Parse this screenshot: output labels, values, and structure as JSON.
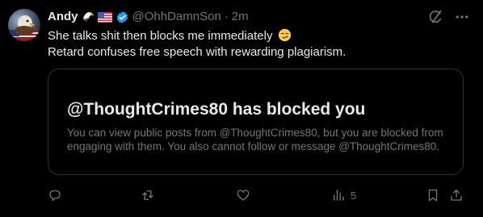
{
  "post": {
    "author": {
      "name": "Andy",
      "handle": "@OhhDamnSon",
      "time": "2m",
      "separator": "·",
      "badges": [
        "eagle-emoji",
        "us-flag-emoji",
        "verified-badge"
      ]
    },
    "text": {
      "line1": "She talks shit then blocks me immediately",
      "line1_emoji": "smirking-face",
      "line2": "Retard confuses free speech with rewarding plagiarism."
    },
    "quoted_card": {
      "title": "@ThoughtCrimes80 has blocked you",
      "description": "You can view public posts from @ThoughtCrimes80, but you are blocked from engaging with them. You also cannot follow or message @ThoughtCrimes80."
    },
    "actions": {
      "views_count": "5",
      "icons": [
        "reply-icon",
        "repost-icon",
        "like-icon",
        "views-icon",
        "bookmark-icon",
        "share-icon"
      ]
    },
    "header_icons": [
      "grok-icon",
      "more-icon"
    ]
  },
  "colors": {
    "background": "#000000",
    "primary_text": "#e7e9ea",
    "secondary_text": "#71767b",
    "border": "#2f3336",
    "verified": "#1d9bf0"
  }
}
